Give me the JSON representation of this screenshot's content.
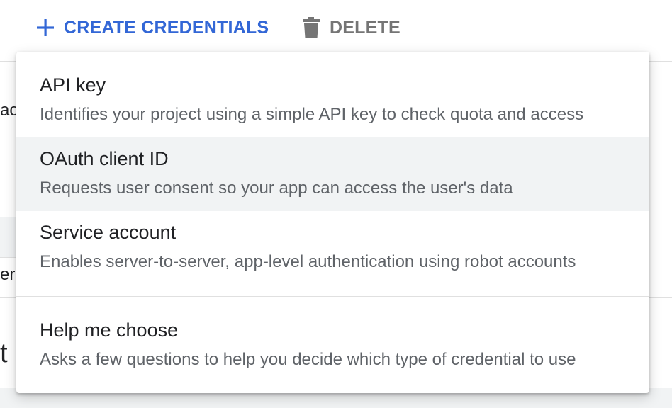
{
  "toolbar": {
    "create_label": "CREATE CREDENTIALS",
    "delete_label": "DELETE",
    "accent_color": "#3367d6",
    "disabled_color": "#757575",
    "create_icon": "plus-icon",
    "delete_icon": "trash-icon"
  },
  "background": {
    "fragment_1": "ac",
    "fragment_2": "er",
    "fragment_3": "t l"
  },
  "menu": {
    "items": [
      {
        "title": "API key",
        "description": "Identifies your project using a simple API key to check quota and access"
      },
      {
        "title": "OAuth client ID",
        "description": "Requests user consent so your app can access the user's data",
        "highlighted": true
      },
      {
        "title": "Service account",
        "description": "Enables server-to-server, app-level authentication using robot accounts"
      },
      {
        "title": "Help me choose",
        "description": "Asks a few questions to help you decide which type of credential to use"
      }
    ]
  }
}
